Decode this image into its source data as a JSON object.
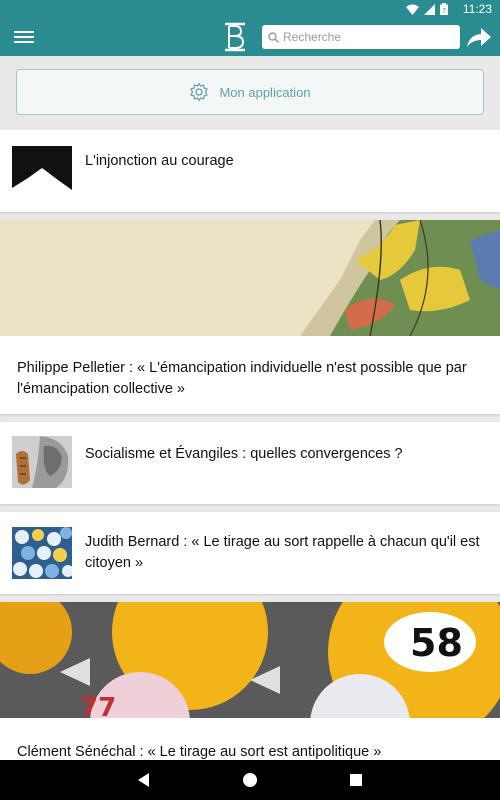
{
  "status_bar": {
    "time": "11:23",
    "icons": [
      "wifi-icon",
      "signal-icon",
      "battery-icon"
    ]
  },
  "app_bar": {
    "menu_icon": "hamburger-menu-icon",
    "logo_icon": "b-logo-icon",
    "search": {
      "placeholder": "Recherche",
      "value": ""
    },
    "share_icon": "share-arrow-icon"
  },
  "app_button": {
    "label": "Mon application",
    "icon": "gear-icon"
  },
  "articles": [
    {
      "title": "L'injonction au courage",
      "thumb_icon": "mountain-thumb"
    },
    {
      "title": "Philippe Pelletier : « L'émancipation individuelle n'est possible que par l'émancipation collective »",
      "thumb_icon": "map-banner"
    },
    {
      "title": "Socialisme et Évangiles : quelles convergences ?",
      "thumb_icon": "che-thumb"
    },
    {
      "title": "Judith Bernard : « Le tirage au sort rappelle à chacun qu'il est citoyen »",
      "thumb_icon": "bingo-thumb"
    },
    {
      "title": "Clément Sénéchal : « Le tirage au sort est antipolitique »",
      "thumb_icon": "bingo-balls-banner"
    }
  ],
  "colors": {
    "accent": "#2a8b90",
    "app_button_text": "#5fa2a6",
    "background": "#e9e9e9"
  },
  "nav_bar": {
    "back_icon": "back-triangle-icon",
    "home_icon": "home-circle-icon",
    "recents_icon": "recents-square-icon"
  }
}
